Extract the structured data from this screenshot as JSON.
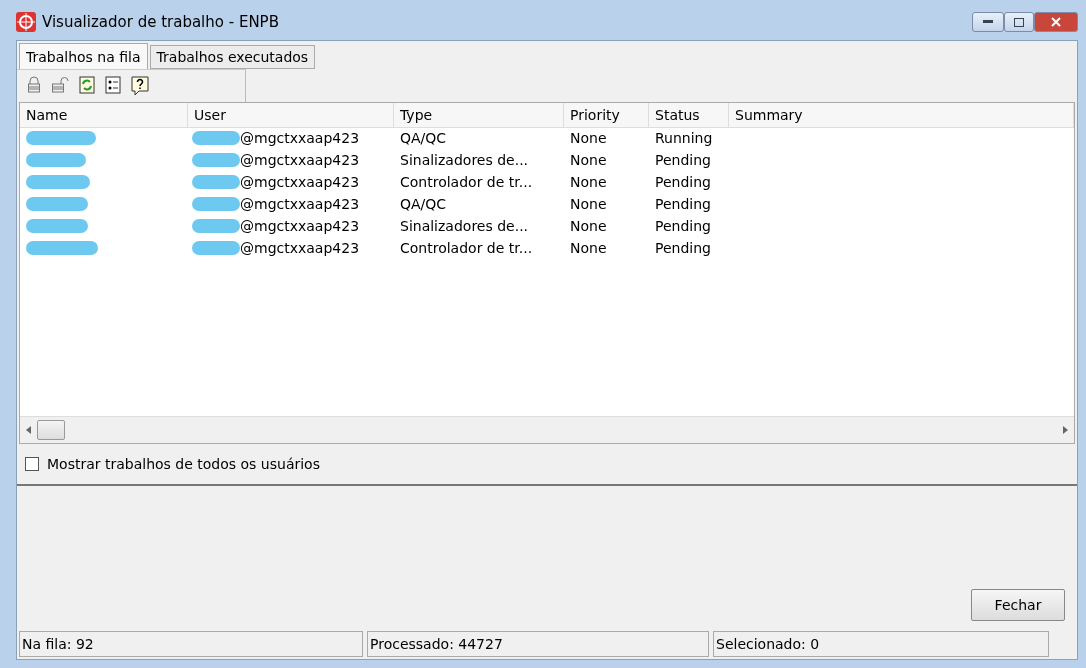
{
  "window": {
    "title": "Visualizador de trabalho - ENPB"
  },
  "tabs": [
    {
      "label": "Trabalhos na fila",
      "selected": true
    },
    {
      "label": "Trabalhos executados",
      "selected": false
    }
  ],
  "toolbar": [
    {
      "kind": "lock"
    },
    {
      "kind": "unlock"
    },
    {
      "kind": "refresh"
    },
    {
      "kind": "details"
    },
    {
      "kind": "help"
    }
  ],
  "table": {
    "columns": [
      "Name",
      "User",
      "Type",
      "Priority",
      "Status",
      "Summary"
    ],
    "rows": [
      {
        "user": "@mgctxxaap423",
        "type": "QA/QC",
        "priority": "None",
        "status": "Running"
      },
      {
        "user": "@mgctxxaap423",
        "type": "Sinalizadores de...",
        "priority": "None",
        "status": "Pending"
      },
      {
        "user": "@mgctxxaap423",
        "type": "Controlador de tr...",
        "priority": "None",
        "status": "Pending"
      },
      {
        "user": "@mgctxxaap423",
        "type": "QA/QC",
        "priority": "None",
        "status": "Pending"
      },
      {
        "user": "@mgctxxaap423",
        "type": "Sinalizadores de...",
        "priority": "None",
        "status": "Pending"
      },
      {
        "user": "@mgctxxaap423",
        "type": "Controlador de tr...",
        "priority": "None",
        "status": "Pending"
      }
    ]
  },
  "show_all_users": {
    "label": "Mostrar trabalhos de todos os usuários",
    "checked": false
  },
  "buttons": [
    "Fechar"
  ],
  "status_bar": [
    "Na fila: 92",
    "Processado: 44727",
    "Selecionado: 0"
  ]
}
